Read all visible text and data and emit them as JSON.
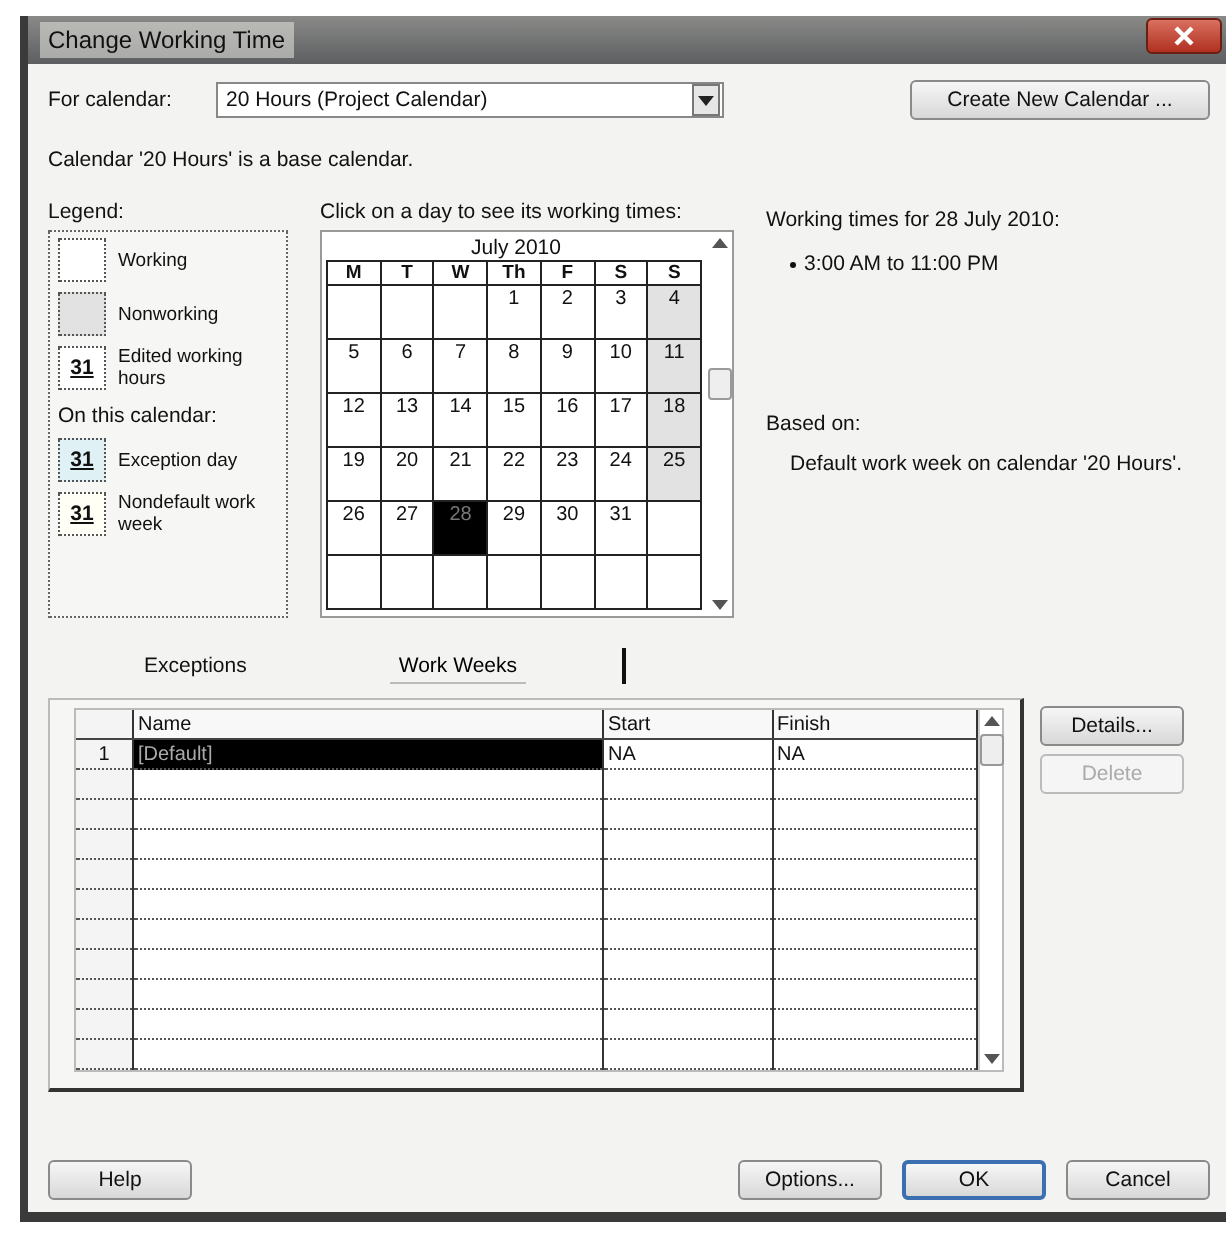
{
  "window": {
    "title": "Change Working Time"
  },
  "for_calendar": {
    "label": "For calendar:",
    "value": "20 Hours (Project Calendar)"
  },
  "create_button": "Create New Calendar ...",
  "base_note": "Calendar '20 Hours' is a base calendar.",
  "legend": {
    "title": "Legend:",
    "items": [
      {
        "kind": "working",
        "label": "Working"
      },
      {
        "kind": "nonworking",
        "label": "Nonworking"
      },
      {
        "kind": "edited",
        "label": "Edited working hours",
        "mark": "31"
      },
      {
        "kind": "heading",
        "label": "On this calendar:"
      },
      {
        "kind": "exception",
        "label": "Exception day",
        "mark": "31"
      },
      {
        "kind": "nondefault",
        "label": "Nondefault work week",
        "mark": "31"
      }
    ]
  },
  "calendar": {
    "instruction": "Click on a day to see its working times:",
    "month": "July 2010",
    "weekdays": [
      "M",
      "T",
      "W",
      "Th",
      "F",
      "S",
      "S"
    ],
    "weeks": [
      [
        {
          "nonworking": false,
          "selected": false
        },
        {
          "nonworking": false,
          "selected": false
        },
        {
          "nonworking": false,
          "selected": false
        },
        {
          "day": "1",
          "nonworking": false,
          "selected": false
        },
        {
          "day": "2",
          "nonworking": false,
          "selected": false
        },
        {
          "day": "3",
          "nonworking": false,
          "selected": false
        },
        {
          "day": "4",
          "nonworking": true,
          "selected": false
        }
      ],
      [
        {
          "day": "5",
          "nonworking": false,
          "selected": false
        },
        {
          "day": "6",
          "nonworking": false,
          "selected": false
        },
        {
          "day": "7",
          "nonworking": false,
          "selected": false
        },
        {
          "day": "8",
          "nonworking": false,
          "selected": false
        },
        {
          "day": "9",
          "nonworking": false,
          "selected": false
        },
        {
          "day": "10",
          "nonworking": false,
          "selected": false
        },
        {
          "day": "11",
          "nonworking": true,
          "selected": false
        }
      ],
      [
        {
          "day": "12",
          "nonworking": false,
          "selected": false
        },
        {
          "day": "13",
          "nonworking": false,
          "selected": false
        },
        {
          "day": "14",
          "nonworking": false,
          "selected": false
        },
        {
          "day": "15",
          "nonworking": false,
          "selected": false
        },
        {
          "day": "16",
          "nonworking": false,
          "selected": false
        },
        {
          "day": "17",
          "nonworking": false,
          "selected": false
        },
        {
          "day": "18",
          "nonworking": true,
          "selected": false
        }
      ],
      [
        {
          "day": "19",
          "nonworking": false,
          "selected": false
        },
        {
          "day": "20",
          "nonworking": false,
          "selected": false
        },
        {
          "day": "21",
          "nonworking": false,
          "selected": false
        },
        {
          "day": "22",
          "nonworking": false,
          "selected": false
        },
        {
          "day": "23",
          "nonworking": false,
          "selected": false
        },
        {
          "day": "24",
          "nonworking": false,
          "selected": false
        },
        {
          "day": "25",
          "nonworking": true,
          "selected": false
        }
      ],
      [
        {
          "day": "26",
          "nonworking": false,
          "selected": false
        },
        {
          "day": "27",
          "nonworking": false,
          "selected": false
        },
        {
          "day": "28",
          "nonworking": false,
          "selected": true
        },
        {
          "day": "29",
          "nonworking": false,
          "selected": false
        },
        {
          "day": "30",
          "nonworking": false,
          "selected": false
        },
        {
          "day": "31",
          "nonworking": false,
          "selected": false
        },
        {
          "nonworking": false,
          "selected": false
        }
      ],
      [
        {
          "nonworking": false,
          "selected": false
        },
        {
          "nonworking": false,
          "selected": false
        },
        {
          "nonworking": false,
          "selected": false
        },
        {
          "nonworking": false,
          "selected": false
        },
        {
          "nonworking": false,
          "selected": false
        },
        {
          "nonworking": false,
          "selected": false
        },
        {
          "nonworking": false,
          "selected": false
        }
      ]
    ]
  },
  "working_times": {
    "title": "Working times for 28 July 2010:",
    "items": [
      "3:00 AM to 11:00 PM"
    ],
    "based_on_label": "Based on:",
    "based_on": "Default work week on calendar '20 Hours'."
  },
  "tabs": [
    {
      "label": "Exceptions",
      "selected": false
    },
    {
      "label": "Work Weeks",
      "selected": true
    }
  ],
  "table": {
    "columns": [
      "Name",
      "Start",
      "Finish"
    ],
    "rows": [
      {
        "number": "1",
        "name": "[Default]",
        "start": "NA",
        "finish": "NA",
        "selected": true
      }
    ]
  },
  "side_buttons": [
    {
      "label": "Details...",
      "disabled": false
    },
    {
      "label": "Delete",
      "disabled": true
    }
  ],
  "footer_buttons": [
    {
      "label": "Help",
      "default": false
    },
    {
      "label": "Options...",
      "default": false
    },
    {
      "label": "OK",
      "default": true
    },
    {
      "label": "Cancel",
      "default": false
    }
  ]
}
